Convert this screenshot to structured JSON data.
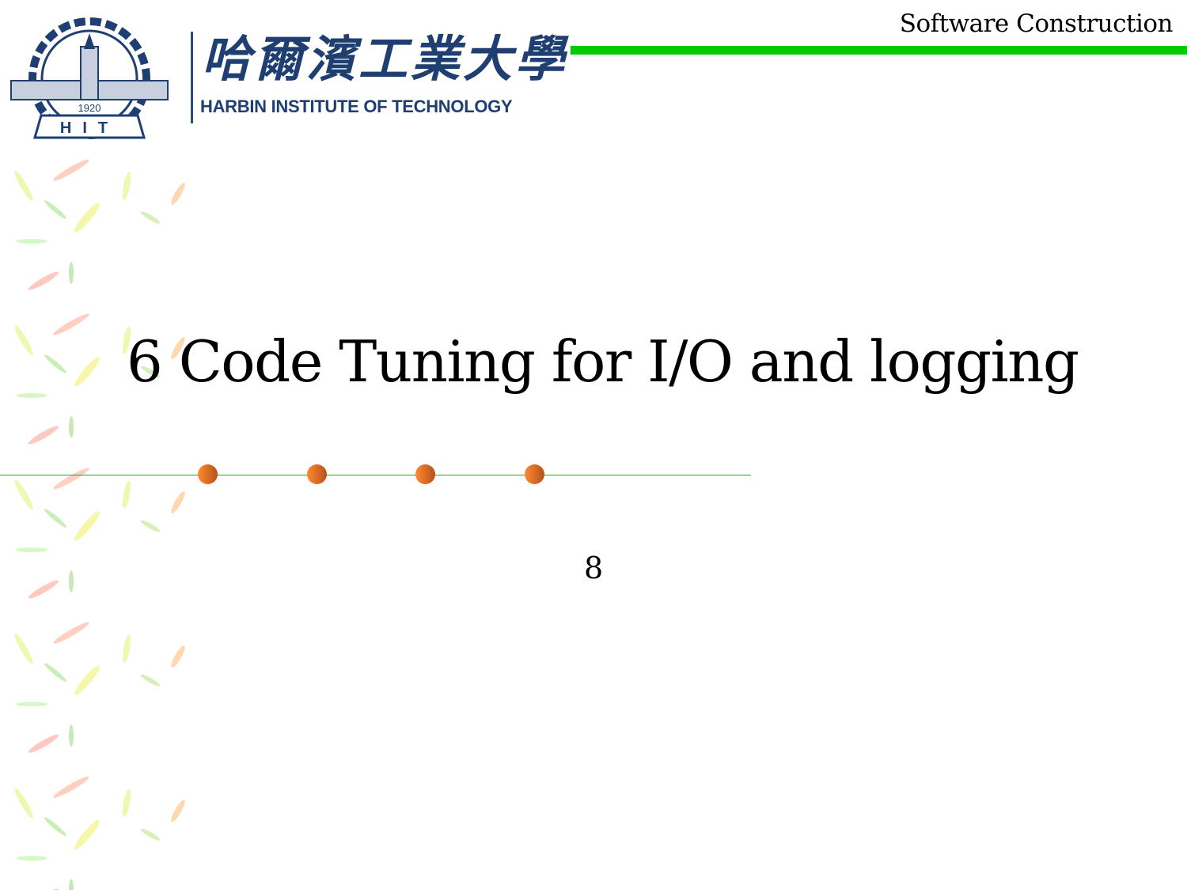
{
  "header": {
    "course_title": "Software Construction",
    "logo": {
      "chinese_name": "哈爾濱工業大學",
      "english_name": "HARBIN INSTITUTE OF TECHNOLOGY",
      "emblem_year": "1920",
      "emblem_letters": "HIT"
    },
    "accent_color": "#00cc00"
  },
  "slide": {
    "title": "6 Code Tuning for I/O and logging",
    "page_number": "8",
    "bullet_color": "#f07a28"
  }
}
